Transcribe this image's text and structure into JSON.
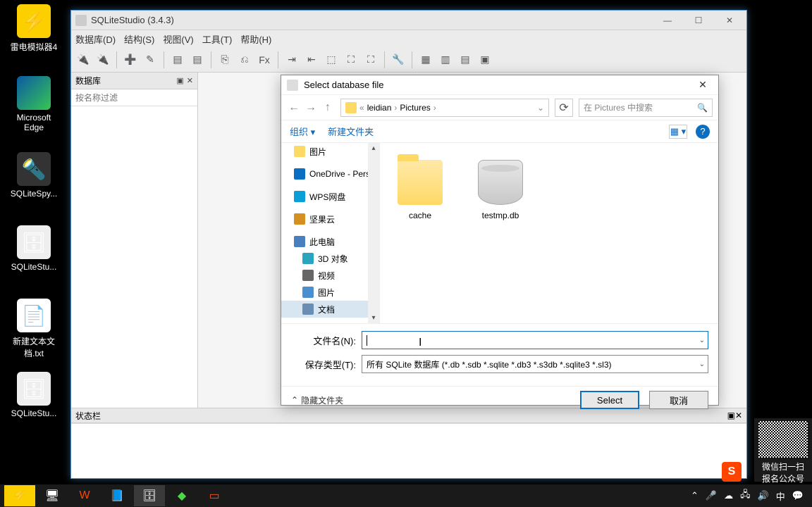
{
  "desktop": {
    "icons": [
      {
        "label": "雷电模拟器4"
      },
      {
        "label": "Microsoft Edge"
      },
      {
        "label": "SQLiteSpy..."
      },
      {
        "label": "SQLiteStu..."
      },
      {
        "label": "新建文本文档.txt"
      },
      {
        "label": "SQLiteStu..."
      }
    ]
  },
  "main_window": {
    "title": "SQLiteStudio (3.4.3)",
    "menus": [
      "数据库(D)",
      "结构(S)",
      "视图(V)",
      "工具(T)",
      "帮助(H)"
    ],
    "db_panel_title": "数据库",
    "filter_placeholder": "按名称过滤",
    "status_title": "状态栏"
  },
  "dialog": {
    "title": "Select database file",
    "breadcrumb": [
      "leidian",
      "Pictures"
    ],
    "breadcrumb_prefix": "«",
    "search_placeholder": "在 Pictures 中搜索",
    "organize": "组织",
    "new_folder": "新建文件夹",
    "tree": [
      {
        "label": "图片",
        "icon": "folder"
      },
      {
        "label": "OneDrive - Pers",
        "icon": "onedrive"
      },
      {
        "label": "WPS网盘",
        "icon": "wps"
      },
      {
        "label": "坚果云",
        "icon": "nut"
      },
      {
        "label": "此电脑",
        "icon": "pc"
      },
      {
        "label": "3D 对象",
        "icon": "3d",
        "sub": true
      },
      {
        "label": "视频",
        "icon": "vid",
        "sub": true
      },
      {
        "label": "图片",
        "icon": "pic",
        "sub": true
      },
      {
        "label": "文档",
        "icon": "doc",
        "sub": true,
        "sel": true
      }
    ],
    "files": [
      {
        "name": "cache",
        "type": "folder"
      },
      {
        "name": "testmp.db",
        "type": "db"
      }
    ],
    "filename_label": "文件名(N):",
    "filetype_label": "保存类型(T):",
    "filetype_value": "所有 SQLite 数据库 (*.db *.sdb *.sqlite *.db3 *.s3db *.sqlite3 *.sl3)",
    "hide_folders": "隐藏文件夹",
    "select_btn": "Select",
    "cancel_btn": "取消"
  },
  "qr": {
    "line1": "微信扫一扫",
    "line2": "报名公众号"
  },
  "tray": {
    "ime": "中"
  }
}
